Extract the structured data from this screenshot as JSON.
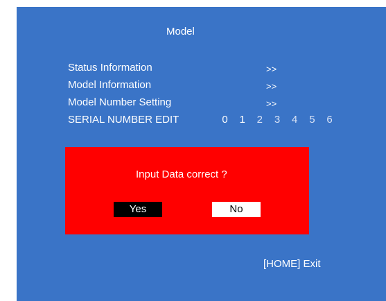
{
  "screen": {
    "title": "Model",
    "menu": [
      {
        "label": "Status Information",
        "arrow": ">>"
      },
      {
        "label": "Model Information",
        "arrow": ">>"
      },
      {
        "label": "Model Number Setting",
        "arrow": ">>"
      }
    ],
    "serial_edit": {
      "label": "SERIAL NUMBER EDIT",
      "digits": [
        "0",
        "1",
        "2",
        "3",
        "4",
        "5",
        "6"
      ]
    },
    "footer": "[HOME] Exit"
  },
  "dialog": {
    "message": "Input Data correct ?",
    "yes_label": "Yes",
    "no_label": "No"
  },
  "colors": {
    "screen_bg": "#3a74c7",
    "dialog_bg": "#ff0000",
    "selected_button_bg": "#000000",
    "unselected_button_bg": "#ffffff"
  }
}
